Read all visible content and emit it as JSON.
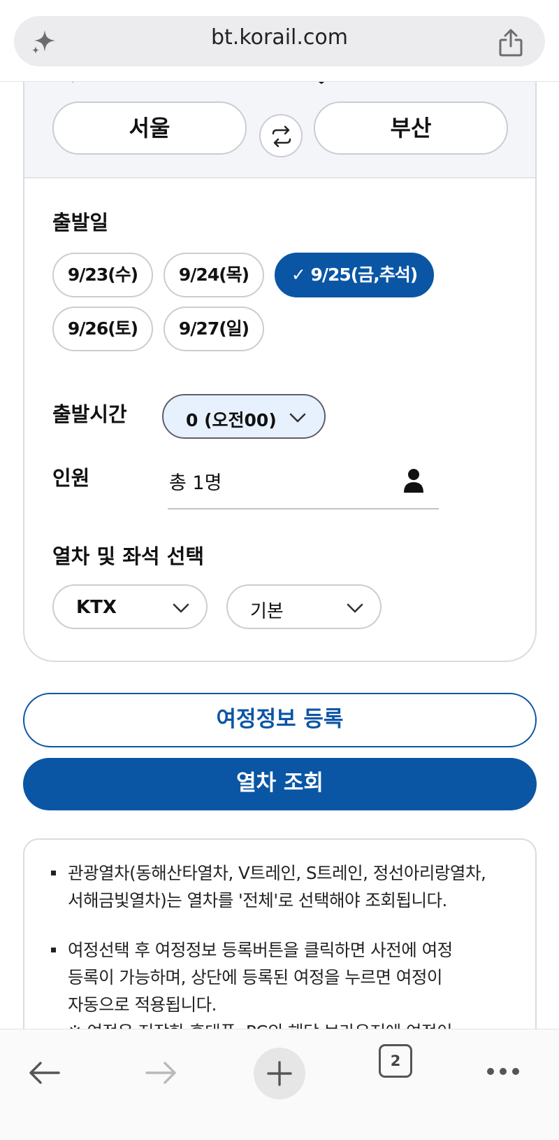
{
  "browser": {
    "url": "bt.korail.com",
    "tab_count": "2"
  },
  "route": {
    "departure": "서울",
    "arrival": "부산"
  },
  "dates": {
    "label": "출발일",
    "options": [
      "9/23(수)",
      "9/24(목)",
      "✓ 9/25(금,추석)",
      "9/26(토)",
      "9/27(일)"
    ],
    "selected_index": 2
  },
  "time": {
    "label": "출발시간",
    "value": "0 (오전00)"
  },
  "passengers": {
    "label": "인원",
    "value": "총 1명"
  },
  "train_seat": {
    "label": "열차 및 좌석 선택",
    "train_type": "KTX",
    "seat_type": "기본"
  },
  "actions": {
    "register_label": "여정정보 등록",
    "search_label": "열차 조회"
  },
  "notices": [
    {
      "lines": [
        "관광열차(동해산타열차, V트레인, S트레인, 정선아리랑열차,",
        "서해금빛열차)는 열차를 '전체'로 선택해야 조회됩니다."
      ]
    },
    {
      "lines": [
        "여정선택 후 여정정보 등록버튼을 클릭하면 사전에 여정",
        "등록이 가능하며, 상단에 등록된 여정을 누르면 여정이",
        "자동으로 적용됩니다.",
        "※ 여정은 저장한 휴대폰, PC의 해당 브라우저에 여정이"
      ]
    }
  ],
  "colors": {
    "primary": "#0a56a5",
    "time_select_bg": "#e7f1fd",
    "card_top_bg": "#f3f5f9"
  },
  "icons": {
    "sparkle": "sparkle-icon",
    "share": "share-icon",
    "swap": "swap-icon",
    "person": "person-icon",
    "chevron": "chevron-down-icon",
    "back": "back-arrow-icon",
    "forward": "forward-arrow-icon",
    "new_tab": "plus-icon",
    "tabs": "tabs-icon",
    "more": "more-icon"
  }
}
